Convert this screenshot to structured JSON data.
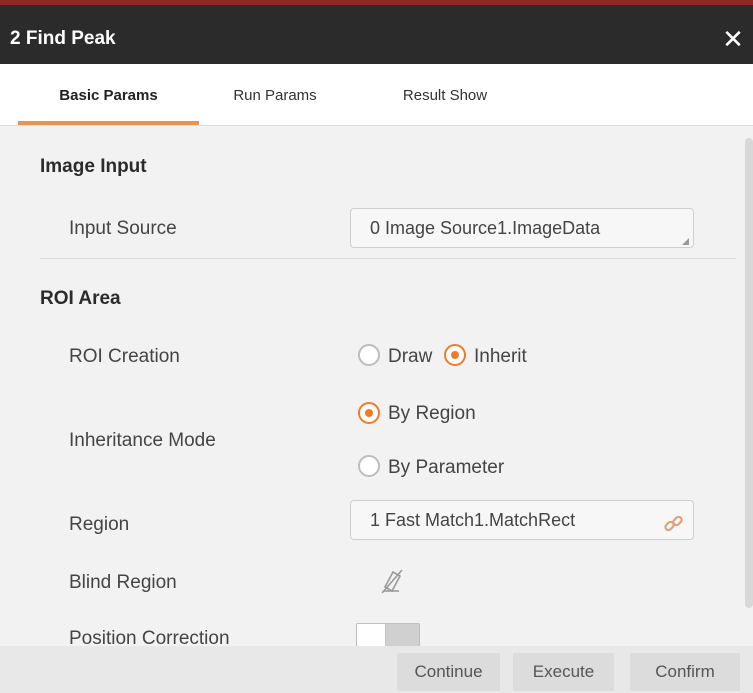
{
  "window": {
    "title": "2 Find Peak",
    "close_icon": "close-icon"
  },
  "tabs": [
    {
      "label": "Basic Params",
      "active": true
    },
    {
      "label": "Run Params",
      "active": false
    },
    {
      "label": "Result Show",
      "active": false
    }
  ],
  "image_input": {
    "title": "Image Input",
    "input_source_label": "Input Source",
    "input_source_value": "0 Image Source1.ImageData"
  },
  "roi_area": {
    "title": "ROI Area",
    "roi_creation_label": "ROI Creation",
    "roi_options": [
      {
        "label": "Draw",
        "selected": false
      },
      {
        "label": "Inherit",
        "selected": true
      }
    ],
    "inheritance_mode_label": "Inheritance Mode",
    "inheritance_options": [
      {
        "label": "By Region",
        "selected": true
      },
      {
        "label": "By Parameter",
        "selected": false
      }
    ],
    "region_label": "Region",
    "region_value": "1 Fast Match1.MatchRect",
    "region_link_icon": "link-icon",
    "blind_region_label": "Blind Region",
    "blind_region_icon": "eraser-icon",
    "position_correction_label": "Position Correction",
    "position_correction_on": false
  },
  "footer": {
    "continue_label": "Continue",
    "execute_label": "Execute",
    "confirm_label": "Confirm"
  },
  "colors": {
    "accent": "#f07c2a",
    "titlebar": "#2b2b2b",
    "title_border": "#8c2a22"
  }
}
